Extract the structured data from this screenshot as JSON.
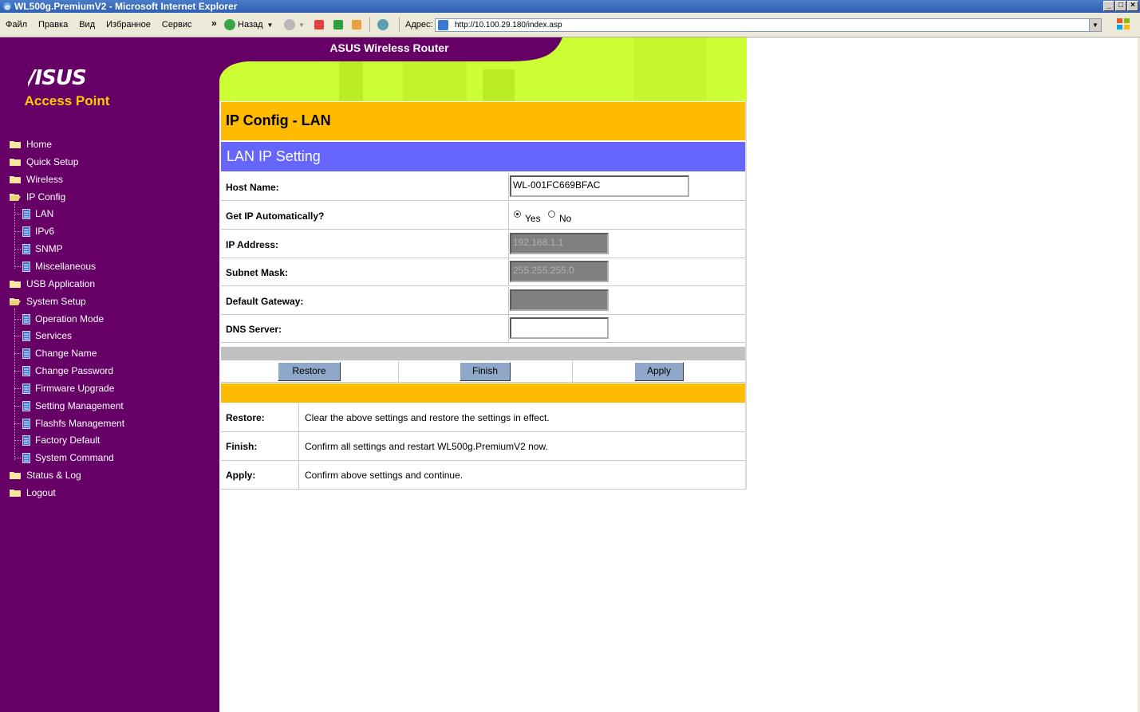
{
  "window": {
    "title": "WL500g.PremiumV2 - Microsoft Internet Explorer",
    "controls": [
      "_",
      "□",
      "×"
    ]
  },
  "menubar": {
    "items": [
      "Файл",
      "Правка",
      "Вид",
      "Избранное",
      "Сервис"
    ],
    "more": "»"
  },
  "toolbar": {
    "back_label": "Назад",
    "address_label": "Адрес:",
    "address_value": "http://10.100.29.180/index.asp"
  },
  "sidebar": {
    "brand": "/ISUS",
    "subtitle": "Access Point",
    "items": [
      {
        "label": "Home",
        "type": "folder"
      },
      {
        "label": "Quick Setup",
        "type": "folder"
      },
      {
        "label": "Wireless",
        "type": "folder"
      },
      {
        "label": "IP Config",
        "type": "folder-open"
      },
      {
        "label": "LAN",
        "type": "page"
      },
      {
        "label": "IPv6",
        "type": "page"
      },
      {
        "label": "SNMP",
        "type": "page"
      },
      {
        "label": "Miscellaneous",
        "type": "page"
      },
      {
        "label": "USB Application",
        "type": "folder"
      },
      {
        "label": "System Setup",
        "type": "folder-open"
      },
      {
        "label": "Operation Mode",
        "type": "page"
      },
      {
        "label": "Services",
        "type": "page"
      },
      {
        "label": "Change Name",
        "type": "page"
      },
      {
        "label": "Change Password",
        "type": "page"
      },
      {
        "label": "Firmware Upgrade",
        "type": "page"
      },
      {
        "label": "Setting Management",
        "type": "page"
      },
      {
        "label": "Flashfs Management",
        "type": "page"
      },
      {
        "label": "Factory Default",
        "type": "page"
      },
      {
        "label": "System Command",
        "type": "page"
      },
      {
        "label": "Status & Log",
        "type": "folder"
      },
      {
        "label": "Logout",
        "type": "folder"
      }
    ]
  },
  "banner": {
    "title": "ASUS Wireless Router"
  },
  "page": {
    "title": "IP Config - LAN",
    "section": "LAN IP Setting"
  },
  "form": {
    "host_name": {
      "label": "Host Name:",
      "value": "WL-001FC669BFAC"
    },
    "get_ip_auto": {
      "label": "Get IP Automatically?",
      "options": [
        "Yes",
        "No"
      ],
      "selected": "Yes"
    },
    "ip_address": {
      "label": "IP Address:",
      "value": "192.168.1.1"
    },
    "subnet_mask": {
      "label": "Subnet Mask:",
      "value": "255.255.255.0"
    },
    "default_gateway": {
      "label": "Default Gateway:",
      "value": ""
    },
    "dns_server": {
      "label": "DNS Server:",
      "value": ""
    }
  },
  "buttons": {
    "restore": "Restore",
    "finish": "Finish",
    "apply": "Apply"
  },
  "help": [
    {
      "label": "Restore:",
      "text": "Clear the above settings and restore the settings in effect."
    },
    {
      "label": "Finish:",
      "text": "Confirm all settings and restart WL500g.PremiumV2 now."
    },
    {
      "label": "Apply:",
      "text": "Confirm above settings and continue."
    }
  ],
  "colors": {
    "sidebar_bg": "#660066",
    "banner_bg": "#ccff33",
    "title_bar": "#ffbb00",
    "section_bar": "#6666ff",
    "accent_text": "#ffcc00"
  }
}
